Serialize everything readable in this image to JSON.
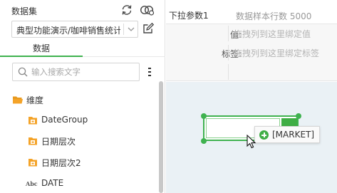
{
  "left_panel": {
    "title": "数据集",
    "refresh_icon": "refresh-icon",
    "link_icon": "dataset-link-icon",
    "dataset_select": {
      "value": "典型功能演示/咖啡销售统计"
    },
    "tab_label": "数据",
    "search": {
      "placeholder": "输入搜索文字"
    },
    "tree": {
      "group_label": "维度",
      "items": [
        {
          "label": "DateGroup",
          "icon": "folder-field-icon"
        },
        {
          "label": "日期层次",
          "icon": "folder-field-icon"
        },
        {
          "label": "日期层次2",
          "icon": "folder-field-icon"
        },
        {
          "label": "DATE",
          "icon": "abc-icon",
          "icon_text": "Abc"
        }
      ]
    }
  },
  "right_panel": {
    "title": "下拉参数1",
    "rows_info": "数据样本行数 5000",
    "props": [
      {
        "label": "值:",
        "placeholder": "拖拽列到这里绑定值"
      },
      {
        "label": "标签:",
        "placeholder": "拖拽列到这里绑定标签"
      }
    ]
  },
  "drag_tooltip": {
    "text": "[MARKET]"
  },
  "colors": {
    "accent": "#3fb24f",
    "folder": "#f4a328",
    "canvas": "#eaf1f5"
  }
}
